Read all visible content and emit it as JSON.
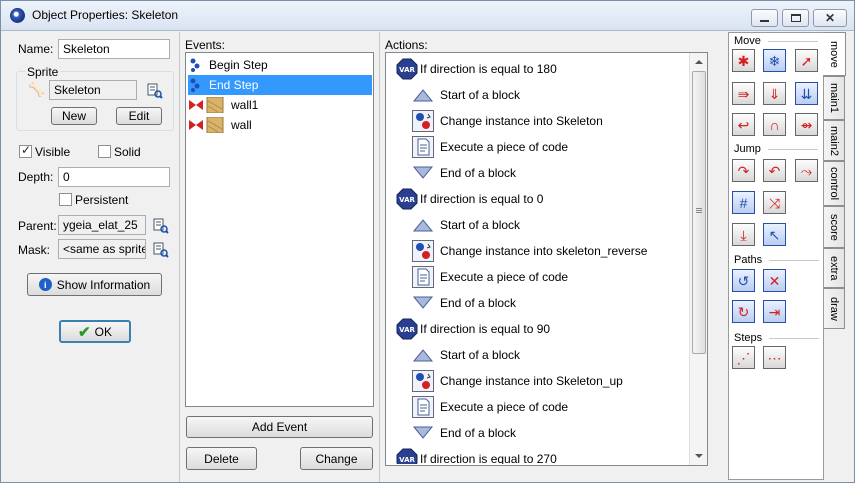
{
  "window": {
    "title": "Object Properties: Skeleton"
  },
  "left": {
    "name_label": "Name:",
    "name_value": "Skeleton",
    "sprite_group": "Sprite",
    "sprite_value": "Skeleton",
    "new_label": "New",
    "edit_label": "Edit",
    "visible_label": "Visible",
    "visible_checked": true,
    "solid_label": "Solid",
    "solid_checked": false,
    "depth_label": "Depth:",
    "depth_value": "0",
    "persistent_label": "Persistent",
    "persistent_checked": false,
    "parent_label": "Parent:",
    "parent_value": "ygeia_elat_25",
    "mask_label": "Mask:",
    "mask_value": "<same as sprite>",
    "show_info_label": "Show Information",
    "ok_label": "OK"
  },
  "events": {
    "header": "Events:",
    "items": [
      {
        "label": "Begin Step",
        "icon": "step-icon",
        "selected": false
      },
      {
        "label": "End Step",
        "icon": "step-icon",
        "selected": true
      },
      {
        "label": "wall1",
        "icon": "collision-icon",
        "selected": false
      },
      {
        "label": "wall",
        "icon": "collision-icon",
        "selected": false
      }
    ],
    "add_label": "Add Event",
    "delete_label": "Delete",
    "change_label": "Change"
  },
  "actions": {
    "header": "Actions:",
    "items": [
      {
        "label": "If direction is equal to 180",
        "icon": "var-icon",
        "indent": false
      },
      {
        "label": "Start of a block",
        "icon": "start-block-icon",
        "indent": true
      },
      {
        "label": "Change instance into Skeleton",
        "icon": "change-instance-icon",
        "indent": true
      },
      {
        "label": "Execute a piece of code",
        "icon": "code-icon",
        "indent": true
      },
      {
        "label": "End of a block",
        "icon": "end-block-icon",
        "indent": true
      },
      {
        "label": "If direction is equal to 0",
        "icon": "var-icon",
        "indent": false
      },
      {
        "label": "Start of a block",
        "icon": "start-block-icon",
        "indent": true
      },
      {
        "label": "Change instance into skeleton_reverse",
        "icon": "change-instance-icon",
        "indent": true
      },
      {
        "label": "Execute a piece of code",
        "icon": "code-icon",
        "indent": true
      },
      {
        "label": "End of a block",
        "icon": "end-block-icon",
        "indent": true
      },
      {
        "label": "If direction is equal to 90",
        "icon": "var-icon",
        "indent": false
      },
      {
        "label": "Start of a block",
        "icon": "start-block-icon",
        "indent": true
      },
      {
        "label": "Change instance into Skeleton_up",
        "icon": "change-instance-icon",
        "indent": true
      },
      {
        "label": "Execute a piece of code",
        "icon": "code-icon",
        "indent": true
      },
      {
        "label": "End of a block",
        "icon": "end-block-icon",
        "indent": true
      },
      {
        "label": "If direction is equal to 270",
        "icon": "var-icon",
        "indent": false
      }
    ]
  },
  "palette": {
    "sections": {
      "move": "Move",
      "jump": "Jump",
      "paths": "Paths",
      "steps": "Steps"
    },
    "tabs": [
      "move",
      "main1",
      "main2",
      "control",
      "score",
      "extra",
      "draw"
    ],
    "active_tab": "move"
  },
  "colors": {
    "accent": "#3399ff",
    "icon_red": "#d42020",
    "icon_blue": "#1f4fb0"
  }
}
